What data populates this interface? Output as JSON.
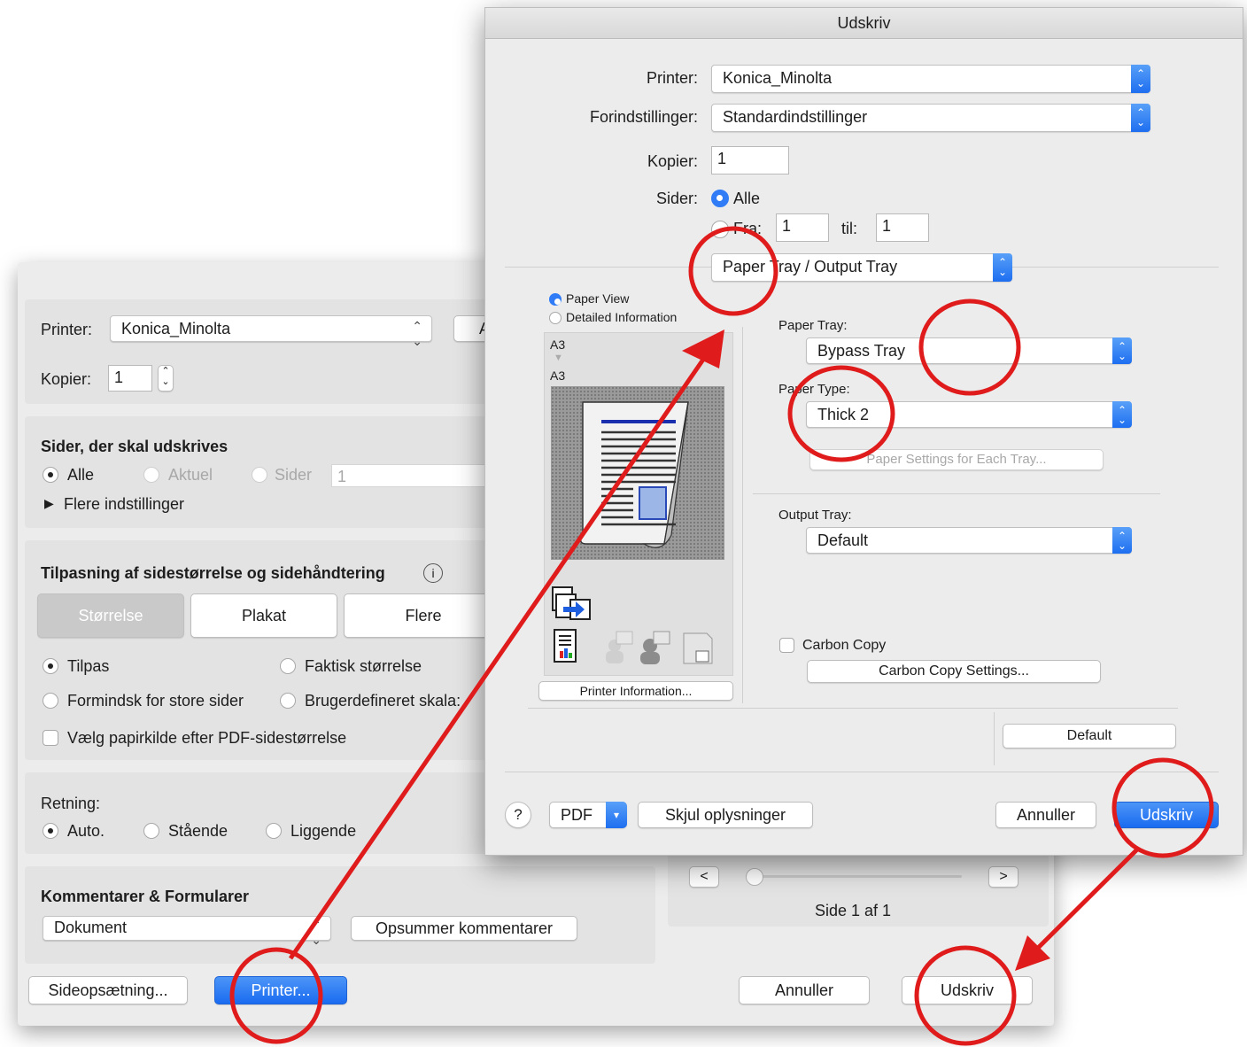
{
  "back_dialog": {
    "printer_label": "Printer:",
    "printer_value": "Konica_Minolta",
    "advanced_button_partial": "A",
    "copies_label": "Kopier:",
    "copies_value": "1",
    "pages_section_title": "Sider, der skal udskrives",
    "pages_options": [
      "Alle",
      "Aktuel",
      "Sider"
    ],
    "pages_range_value": "1",
    "more_settings": "Flere indstillinger",
    "sizing_section_title": "Tilpasning af sidestørrelse og sidehåndtering",
    "sizing_tabs": [
      "Størrelse",
      "Plakat",
      "Flere"
    ],
    "sizing_options": [
      "Tilpas",
      "Faktisk størrelse",
      "Formindsk for store sider",
      "Brugerdefineret skala:"
    ],
    "paper_source_checkbox": "Vælg papirkilde efter PDF-sidestørrelse",
    "orientation_label": "Retning:",
    "orientation_options": [
      "Auto.",
      "Stående",
      "Liggende"
    ],
    "comments_title": "Kommentarer & Formularer",
    "comments_value": "Dokument",
    "summarize_button": "Opsummer kommentarer",
    "page_nav_prev": "<",
    "page_nav_next": ">",
    "page_counter": "Side 1 af 1",
    "page_setup_button": "Sideopsætning...",
    "printer_button": "Printer...",
    "cancel_button": "Annuller",
    "print_button": "Udskriv"
  },
  "front_dialog": {
    "title": "Udskriv",
    "printer_label": "Printer:",
    "printer_value": "Konica_Minolta",
    "presets_label": "Forindstillinger:",
    "presets_value": "Standardindstillinger",
    "copies_label": "Kopier:",
    "copies_value": "1",
    "pages_label": "Sider:",
    "pages_all": "Alle",
    "pages_from": "Fra:",
    "pages_from_value": "1",
    "pages_to": "til:",
    "pages_to_value": "1",
    "panel_value": "Paper Tray / Output Tray",
    "view_options": [
      "Paper View",
      "Detailed Information"
    ],
    "paper_size_top": "A3",
    "paper_size_bottom": "A3",
    "printer_info_button": "Printer Information...",
    "paper_tray_label": "Paper Tray:",
    "paper_tray_value": "Bypass Tray",
    "paper_type_label": "Paper Type:",
    "paper_type_value": "Thick 2",
    "paper_settings_button": "Paper Settings for Each Tray...",
    "output_tray_label": "Output Tray:",
    "output_tray_value": "Default",
    "carbon_copy_label": "Carbon Copy",
    "carbon_copy_settings_button": "Carbon Copy Settings...",
    "default_button": "Default",
    "help_button": "?",
    "pdf_button": "PDF",
    "hide_details_button": "Skjul oplysninger",
    "cancel_button": "Annuller",
    "print_button": "Udskriv"
  },
  "colors": {
    "annotation_red": "#e01b1b",
    "accent_blue": "#1a6bf0"
  }
}
